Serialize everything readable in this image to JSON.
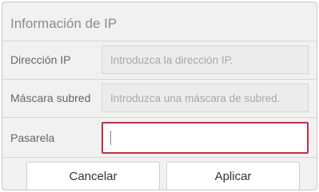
{
  "dialog": {
    "title": "Información de IP",
    "rows": [
      {
        "label": "Dirección IP",
        "value": "",
        "placeholder": "Introduzca la dirección IP."
      },
      {
        "label": "Máscara subred",
        "value": "",
        "placeholder": "Introduzca una máscara de subred."
      },
      {
        "label": "Pasarela",
        "value": "",
        "placeholder": ""
      }
    ],
    "buttons": {
      "cancel": "Cancelar",
      "apply": "Aplicar"
    },
    "colors": {
      "active_border": "#c62c47",
      "background": "#f1f1f1"
    }
  }
}
